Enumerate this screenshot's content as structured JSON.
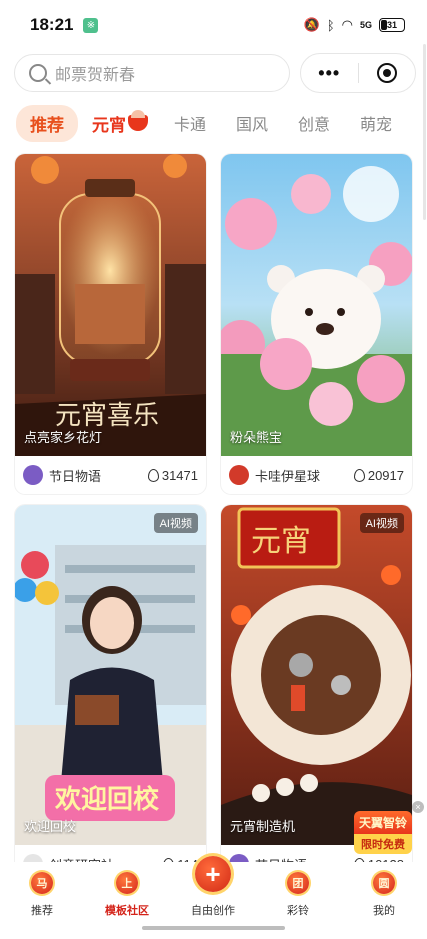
{
  "status_bar": {
    "time": "18:21",
    "app_badge": "※",
    "signal": "5G",
    "battery": "31"
  },
  "search": {
    "placeholder": "邮票贺新春"
  },
  "capsule": {
    "more": "•••"
  },
  "tabs": [
    {
      "label": "推荐"
    },
    {
      "label": "元宵"
    },
    {
      "label": "卡通"
    },
    {
      "label": "国风"
    },
    {
      "label": "创意"
    },
    {
      "label": "萌宠"
    }
  ],
  "cards": [
    {
      "caption": "点亮家乡花灯",
      "author": "节日物语",
      "likes": "31471",
      "ai_tag": ""
    },
    {
      "caption": "粉朵熊宝",
      "author": "卡哇伊星球",
      "likes": "20917",
      "ai_tag": ""
    },
    {
      "caption": "欢迎回校",
      "author": "创意研究社",
      "likes": "114",
      "ai_tag": "AI视频"
    },
    {
      "caption": "元宵制造机",
      "author": "节日物语",
      "likes": "10128",
      "ai_tag": "AI视频"
    }
  ],
  "promo": {
    "title": "天翼智铃",
    "subtitle": "限时免费"
  },
  "bottom_nav": [
    {
      "label": "推荐",
      "icon": "马"
    },
    {
      "label": "模板社区",
      "icon": "上"
    },
    {
      "label": "自由创作",
      "icon": "+"
    },
    {
      "label": "彩铃",
      "icon": "团"
    },
    {
      "label": "我的",
      "icon": "圆"
    }
  ],
  "colors": {
    "accent": "#e8501d",
    "festive_red": "#d4241a"
  }
}
